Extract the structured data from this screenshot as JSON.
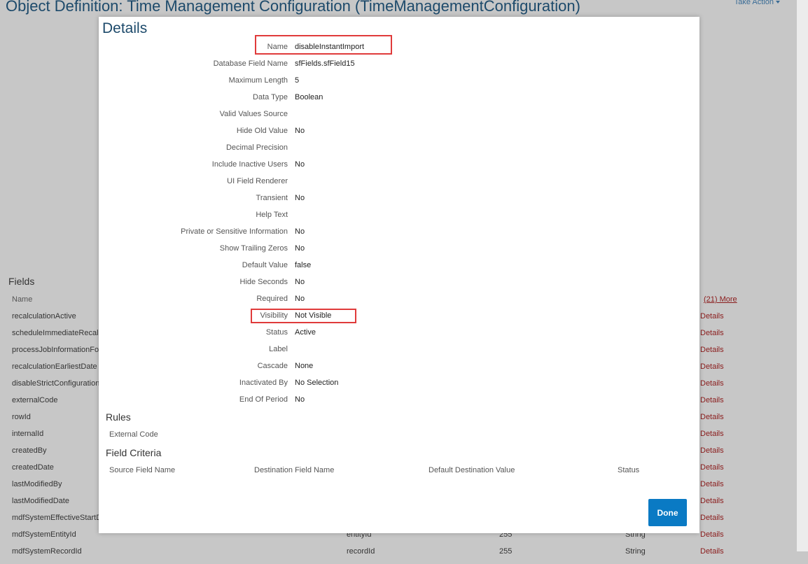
{
  "page": {
    "title": "Object Definition: Time Management Configuration (TimeManagementConfiguration)",
    "take_action": "Take Action"
  },
  "fields_section": {
    "title": "Fields",
    "name_header": "Name",
    "more_link": "(21) More",
    "rows": [
      {
        "name": "recalculationActive",
        "c2": "",
        "c3": "",
        "c4": "",
        "details": "Details"
      },
      {
        "name": "scheduleImmediateRecalculation",
        "c2": "",
        "c3": "",
        "c4": "",
        "details": "Details"
      },
      {
        "name": "processJobInformationForRecalculation",
        "c2": "",
        "c3": "",
        "c4": "",
        "details": "Details"
      },
      {
        "name": "recalculationEarliestDate",
        "c2": "",
        "c3": "",
        "c4": "",
        "details": "Details"
      },
      {
        "name": "disableStrictConfigurationCheck",
        "c2": "",
        "c3": "",
        "c4": "",
        "details": "Details"
      },
      {
        "name": "externalCode",
        "c2": "",
        "c3": "",
        "c4": "",
        "details": "Details"
      },
      {
        "name": "rowId",
        "c2": "",
        "c3": "",
        "c4": "",
        "details": "Details"
      },
      {
        "name": "internalId",
        "c2": "",
        "c3": "",
        "c4": "",
        "details": "Details"
      },
      {
        "name": "createdBy",
        "c2": "",
        "c3": "",
        "c4": "",
        "details": "Details"
      },
      {
        "name": "createdDate",
        "c2": "",
        "c3": "",
        "c4": "",
        "details": "Details"
      },
      {
        "name": "lastModifiedBy",
        "c2": "",
        "c3": "",
        "c4": "",
        "details": "Details"
      },
      {
        "name": "lastModifiedDate",
        "c2": "",
        "c3": "",
        "c4": "",
        "details": "Details"
      },
      {
        "name": "mdfSystemEffectiveStartDate",
        "c2": "",
        "c3": "",
        "c4": "",
        "details": "Details"
      },
      {
        "name": "mdfSystemEntityId",
        "c2": "entityId",
        "c3": "255",
        "c4": "String",
        "details": "Details"
      },
      {
        "name": "mdfSystemRecordId",
        "c2": "recordId",
        "c3": "255",
        "c4": "String",
        "details": "Details"
      }
    ]
  },
  "dialog": {
    "title": "Details",
    "properties": [
      {
        "label": "Name",
        "value": "disableInstantImport"
      },
      {
        "label": "Database Field Name",
        "value": "sfFields.sfField15"
      },
      {
        "label": "Maximum Length",
        "value": "5"
      },
      {
        "label": "Data Type",
        "value": "Boolean"
      },
      {
        "label": "Valid Values Source",
        "value": ""
      },
      {
        "label": "Hide Old Value",
        "value": "No"
      },
      {
        "label": "Decimal Precision",
        "value": ""
      },
      {
        "label": "Include Inactive Users",
        "value": "No"
      },
      {
        "label": "UI Field Renderer",
        "value": ""
      },
      {
        "label": "Transient",
        "value": "No"
      },
      {
        "label": "Help Text",
        "value": ""
      },
      {
        "label": "Private or Sensitive Information",
        "value": "No"
      },
      {
        "label": "Show Trailing Zeros",
        "value": "No"
      },
      {
        "label": "Default Value",
        "value": "false"
      },
      {
        "label": "Hide Seconds",
        "value": "No"
      },
      {
        "label": "Required",
        "value": "No"
      },
      {
        "label": "Visibility",
        "value": "Not Visible"
      },
      {
        "label": "Status",
        "value": "Active"
      },
      {
        "label": "Label",
        "value": ""
      },
      {
        "label": "Cascade",
        "value": "None"
      },
      {
        "label": "Inactivated By",
        "value": "No Selection"
      },
      {
        "label": "End Of Period",
        "value": "No"
      }
    ],
    "rules": {
      "title": "Rules",
      "external_code_header": "External Code"
    },
    "field_criteria": {
      "title": "Field Criteria",
      "headers": [
        "Source Field Name",
        "Destination Field Name",
        "Default Destination Value",
        "Status"
      ]
    },
    "done_label": "Done"
  },
  "colors": {
    "highlight": "#e03b3b",
    "primary_button": "#0a7ac4",
    "details_link": "#8a1b1b",
    "title": "#1d4a6b"
  }
}
